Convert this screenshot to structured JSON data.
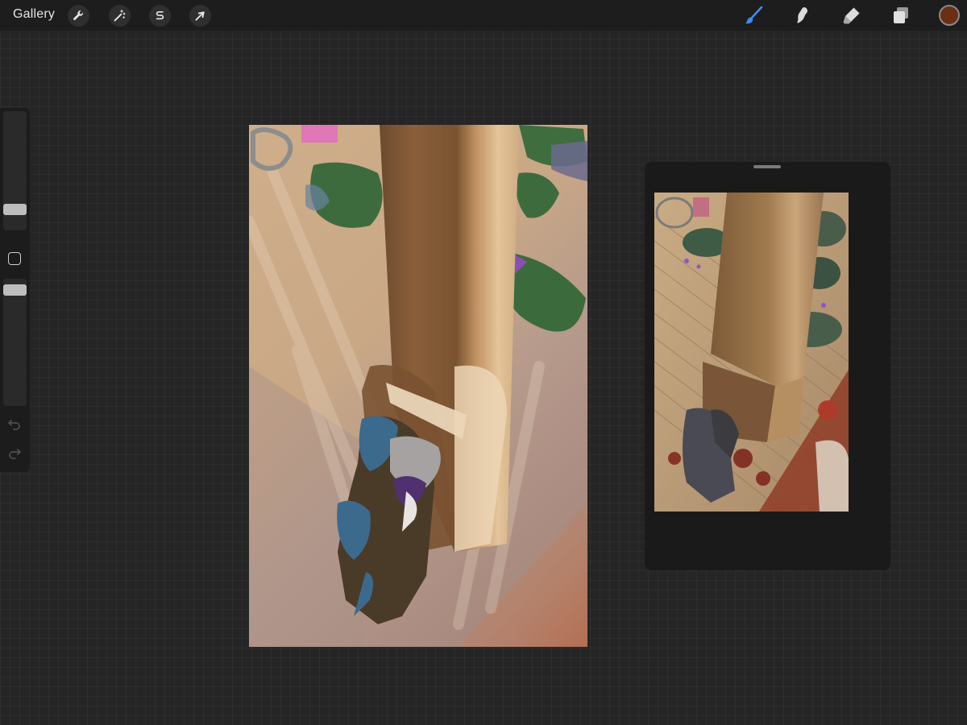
{
  "topbar": {
    "gallery_label": "Gallery",
    "left_tools": [
      {
        "name": "actions",
        "icon": "wrench-icon"
      },
      {
        "name": "adjustments",
        "icon": "magic-wand-icon"
      },
      {
        "name": "selection",
        "icon": "selection-s-icon"
      },
      {
        "name": "transform",
        "icon": "arrow-cursor-icon"
      }
    ],
    "right_tools": [
      {
        "name": "brush",
        "icon": "brush-icon",
        "active": true
      },
      {
        "name": "smudge",
        "icon": "smudge-icon"
      },
      {
        "name": "eraser",
        "icon": "eraser-icon"
      },
      {
        "name": "layers",
        "icon": "layers-icon"
      }
    ],
    "active_color": "#6b2f14",
    "accent_color": "#3b8cf5"
  },
  "sidebar": {
    "brush_size": 0.14,
    "opacity": 0.95,
    "icons": [
      "modify-square-icon",
      "undo-icon",
      "redo-icon"
    ]
  },
  "canvas": {
    "content": "painting-in-progress"
  },
  "reference": {
    "content": "reference-comic-panel"
  }
}
